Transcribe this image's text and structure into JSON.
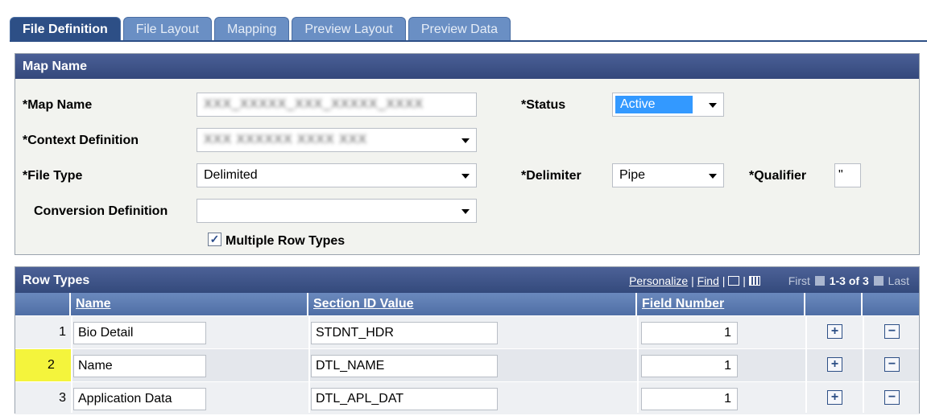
{
  "tabs": [
    {
      "label": "File Definition",
      "active": true
    },
    {
      "label": "File Layout",
      "active": false
    },
    {
      "label": "Mapping",
      "active": false
    },
    {
      "label": "Preview Layout",
      "active": false
    },
    {
      "label": "Preview Data",
      "active": false
    }
  ],
  "map_panel": {
    "title": "Map Name",
    "map_name_label": "*Map Name",
    "map_name_value": "XXX_XXXXX_XXX_XXXXX_XXXX",
    "context_label": "*Context Definition",
    "context_value": "XXX XXXXXX XXXX XXX",
    "file_type_label": "*File Type",
    "file_type_value": "Delimited",
    "conversion_label": "Conversion Definition",
    "conversion_value": "",
    "status_label": "*Status",
    "status_value": "Active",
    "delimiter_label": "*Delimiter",
    "delimiter_value": "Pipe",
    "qualifier_label": "*Qualifier",
    "qualifier_value": "\"",
    "multiple_rows_label": "Multiple Row Types",
    "multiple_rows_checked": true
  },
  "row_types": {
    "title": "Row Types",
    "personalize": "Personalize",
    "find": "Find",
    "first": "First",
    "range": "1-3 of 3",
    "last": "Last",
    "columns": [
      "Name",
      "Section ID Value",
      "Field Number"
    ],
    "rows": [
      {
        "num": "1",
        "name": "Bio Detail",
        "section_id": "STDNT_HDR",
        "field_number": "1"
      },
      {
        "num": "2",
        "name": "Name",
        "section_id": "DTL_NAME",
        "field_number": "1"
      },
      {
        "num": "3",
        "name": "Application Data",
        "section_id": "DTL_APL_DAT",
        "field_number": "1"
      }
    ],
    "add_symbol": "+",
    "delete_symbol": "−"
  },
  "colors": {
    "active_tab": "#2d4f86",
    "inactive_tab": "#6a8fc4",
    "highlight_row": "#f4f43c",
    "status_selection": "#3399ff"
  }
}
